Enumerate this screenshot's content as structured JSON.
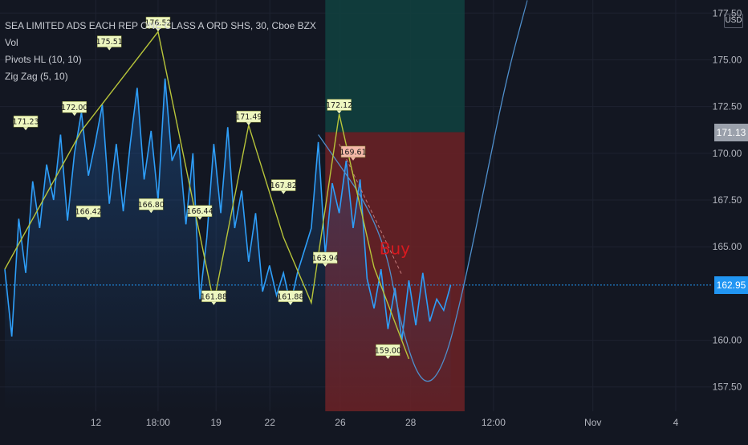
{
  "legend": {
    "symbol": "SEA LIMITED ADS EACH REP ONE CLASS A ORD SHS, 30, Cboe BZX",
    "vol": "Vol",
    "pivots": "Pivots HL (10, 10)",
    "zigzag": "Zig Zag (5, 10)"
  },
  "axis": {
    "currency": "USD",
    "y_ticks": [
      "177.50",
      "175.00",
      "172.50",
      "170.00",
      "167.50",
      "165.00",
      "160.00",
      "157.50"
    ],
    "x_ticks": [
      "12",
      "18:00",
      "19",
      "22",
      "26",
      "28",
      "12:00",
      "Nov",
      "4"
    ]
  },
  "prices": {
    "last": "162.95",
    "last_color": "#2196f3",
    "target": "171.13",
    "target_color": "#9aa0ab"
  },
  "annotation": {
    "text": "Buy",
    "color": "#d8191f"
  },
  "pivot_labels": [
    "176.52",
    "175.51",
    "172.00",
    "171.23",
    "171.49",
    "172.12",
    "169.61",
    "167.82",
    "166.42",
    "166.80",
    "166.44",
    "163.94",
    "161.88",
    "161.88",
    "159.00"
  ],
  "colors": {
    "background": "#131722",
    "price_line": "#2e9ef8",
    "zigzag": "#b7c43a",
    "stop_zone": "#6d2226",
    "target_zone": "#113f3e",
    "projection": "#4f8fcc"
  },
  "chart_data": {
    "type": "line",
    "title": "SEA LIMITED ADS EACH REP ONE CLASS A ORD SHS, 30, Cboe BZX",
    "ylim": [
      156.2,
      178.2
    ],
    "xlim": [
      0,
      100
    ],
    "grid": true,
    "series": [
      {
        "x": [
          0,
          1,
          2,
          3,
          4,
          5,
          6,
          7,
          8,
          9,
          10,
          11,
          12,
          13,
          14,
          15,
          16,
          17,
          18,
          19,
          20,
          21,
          22,
          23,
          24,
          25,
          26,
          27,
          28,
          29,
          30,
          31,
          32,
          33,
          34,
          35,
          36,
          37,
          38,
          39,
          40,
          41,
          42,
          43,
          44,
          45,
          46,
          47,
          48,
          49,
          50,
          51,
          52,
          53,
          54,
          55,
          56,
          57,
          58,
          59,
          60,
          61,
          62,
          63,
          64
        ],
        "values": [
          163.8,
          160.2,
          166.5,
          163.6,
          168.5,
          166.0,
          169.4,
          167.5,
          171.0,
          166.4,
          170.0,
          172.2,
          168.8,
          170.6,
          172.6,
          167.3,
          170.5,
          166.9,
          170.5,
          173.5,
          168.6,
          171.2,
          167.5,
          174.0,
          169.6,
          170.5,
          166.2,
          170.0,
          162.2,
          165.5,
          170.5,
          166.8,
          171.4,
          166.0,
          168.0,
          164.2,
          166.8,
          162.6,
          164.0,
          162.4,
          163.6,
          161.9,
          163.6,
          164.8,
          166.0,
          170.6,
          164.6,
          168.4,
          166.8,
          169.6,
          166.0,
          168.6,
          163.3,
          161.7,
          163.8,
          160.6,
          162.8,
          160.0,
          163.2,
          160.8,
          163.6,
          161.0,
          162.2,
          161.6,
          162.95
        ]
      },
      {
        "x": [
          0,
          11,
          22,
          30,
          35,
          40,
          44,
          48,
          53,
          58
        ],
        "values": [
          163.8,
          171.2,
          176.5,
          162.0,
          171.5,
          165.5,
          162.0,
          172.1,
          163.9,
          159.0
        ]
      },
      {
        "x": [
          45,
          54,
          57,
          60,
          63,
          66,
          69,
          72,
          75
        ],
        "values": [
          171.0,
          166.2,
          160.5,
          157.4,
          158.5,
          163.0,
          168.5,
          174.0,
          178.2
        ]
      }
    ],
    "zones": [
      {
        "x": [
          46,
          66
        ],
        "range": [
          171.13,
          178.2
        ]
      },
      {
        "x": [
          46,
          66
        ],
        "range": [
          156.2,
          171.13
        ]
      }
    ],
    "pivot_points": [
      {
        "x": 22,
        "y": 176.52
      },
      {
        "x": 15,
        "y": 175.51
      },
      {
        "x": 10,
        "y": 172.0
      },
      {
        "x": 3,
        "y": 171.23
      },
      {
        "x": 35,
        "y": 171.49
      },
      {
        "x": 48,
        "y": 172.12
      },
      {
        "x": 50,
        "y": 169.61
      },
      {
        "x": 40,
        "y": 167.82
      },
      {
        "x": 12,
        "y": 166.42
      },
      {
        "x": 21,
        "y": 166.8
      },
      {
        "x": 28,
        "y": 166.44
      },
      {
        "x": 46,
        "y": 163.94
      },
      {
        "x": 30,
        "y": 161.88
      },
      {
        "x": 41,
        "y": 161.88
      },
      {
        "x": 55,
        "y": 159.0
      }
    ],
    "last_price": 162.95,
    "target_price": 171.13
  }
}
